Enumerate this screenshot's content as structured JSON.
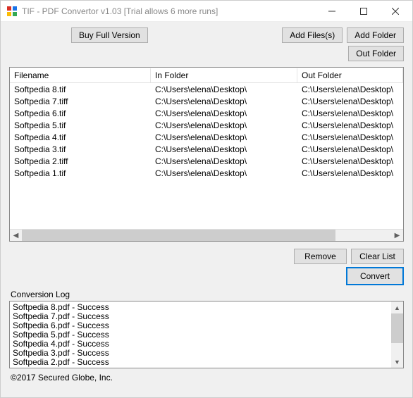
{
  "window": {
    "title": "TIF - PDF Convertor v1.03 [Trial allows 6 more runs]"
  },
  "buttons": {
    "buy": "Buy Full Version",
    "add_files": "Add Files(s)",
    "add_folder": "Add Folder",
    "out_folder": "Out Folder",
    "remove": "Remove",
    "clear": "Clear List",
    "convert": "Convert"
  },
  "table": {
    "headers": {
      "filename": "Filename",
      "in": "In Folder",
      "out": "Out Folder"
    },
    "rows": [
      {
        "name": "Softpedia 8.tif",
        "in": "C:\\Users\\elena\\Desktop\\",
        "out": "C:\\Users\\elena\\Desktop\\"
      },
      {
        "name": "Softpedia 7.tiff",
        "in": "C:\\Users\\elena\\Desktop\\",
        "out": "C:\\Users\\elena\\Desktop\\"
      },
      {
        "name": "Softpedia 6.tif",
        "in": "C:\\Users\\elena\\Desktop\\",
        "out": "C:\\Users\\elena\\Desktop\\"
      },
      {
        "name": "Softpedia 5.tif",
        "in": "C:\\Users\\elena\\Desktop\\",
        "out": "C:\\Users\\elena\\Desktop\\"
      },
      {
        "name": "Softpedia 4.tif",
        "in": "C:\\Users\\elena\\Desktop\\",
        "out": "C:\\Users\\elena\\Desktop\\"
      },
      {
        "name": "Softpedia 3.tif",
        "in": "C:\\Users\\elena\\Desktop\\",
        "out": "C:\\Users\\elena\\Desktop\\"
      },
      {
        "name": "Softpedia 2.tiff",
        "in": "C:\\Users\\elena\\Desktop\\",
        "out": "C:\\Users\\elena\\Desktop\\"
      },
      {
        "name": "Softpedia 1.tif",
        "in": "C:\\Users\\elena\\Desktop\\",
        "out": "C:\\Users\\elena\\Desktop\\"
      }
    ]
  },
  "log": {
    "label": "Conversion Log",
    "lines": [
      "Softpedia 8.pdf - Success",
      "Softpedia 7.pdf - Success",
      "Softpedia 6.pdf - Success",
      "Softpedia 5.pdf - Success",
      "Softpedia 4.pdf - Success",
      "Softpedia 3.pdf - Success",
      "Softpedia 2.pdf - Success"
    ]
  },
  "footer": "©2017 Secured Globe, Inc."
}
